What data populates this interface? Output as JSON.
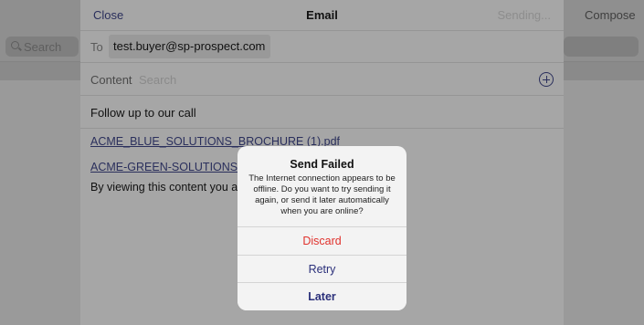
{
  "background": {
    "search_placeholder": "Search",
    "compose_label": "Compose"
  },
  "email": {
    "close_label": "Close",
    "title": "Email",
    "status": "Sending...",
    "to_label": "To",
    "to_value": "test.buyer@sp-prospect.com",
    "content_label": "Content",
    "content_search_placeholder": "Search",
    "subject": "Follow up to our call",
    "attachments": [
      "ACME_BLUE_SOLUTIONS_BROCHURE (1).pdf",
      "ACME-GREEN-SOLUTIONS_BR"
    ],
    "body_text": "By viewing this content you ag"
  },
  "alert": {
    "title": "Send Failed",
    "message": "The Internet connection appears to be offline. Do you want to try sending it again, or send it later automatically when you are online?",
    "buttons": {
      "discard": "Discard",
      "retry": "Retry",
      "later": "Later"
    }
  },
  "colors": {
    "destructive": "#e0322d",
    "accent": "#2a2f7a"
  }
}
